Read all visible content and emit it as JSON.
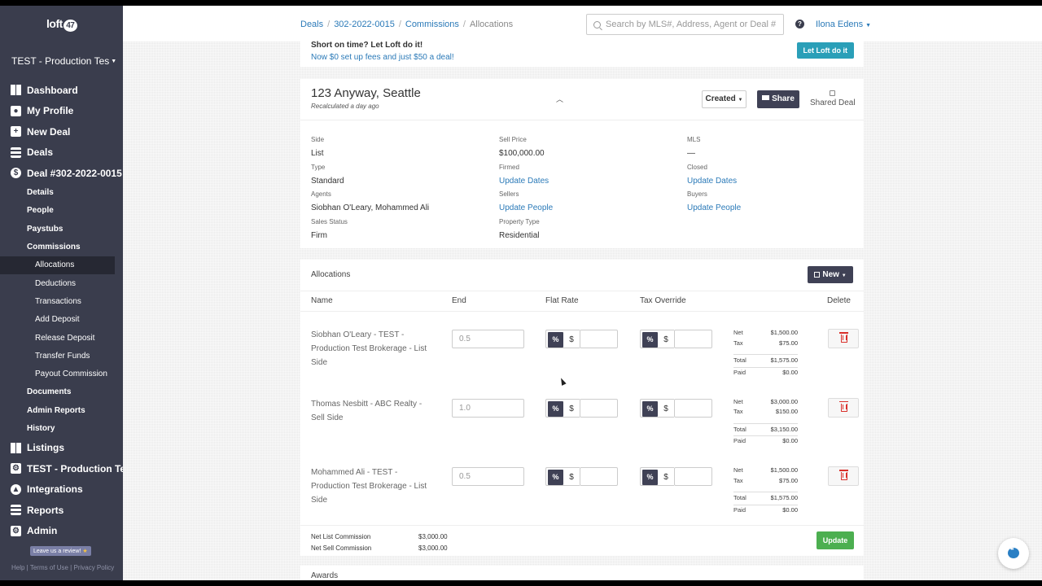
{
  "sidebar": {
    "logo": "loft",
    "logo_badge": "47",
    "org": "TEST - Production Tes",
    "nav": [
      {
        "label": "Dashboard",
        "icon": "dashboard-icon"
      },
      {
        "label": "My Profile",
        "icon": "profile-icon"
      },
      {
        "label": "New Deal",
        "icon": "plus-icon"
      },
      {
        "label": "Deals",
        "icon": "list-icon"
      },
      {
        "label": "Deal #302-2022-0015",
        "icon": "dollar-icon"
      }
    ],
    "sub": [
      {
        "label": "Details"
      },
      {
        "label": "People"
      },
      {
        "label": "Paystubs"
      },
      {
        "label": "Commissions"
      }
    ],
    "deep": [
      {
        "label": "Allocations"
      },
      {
        "label": "Deductions"
      },
      {
        "label": "Transactions"
      },
      {
        "label": "Add Deposit"
      },
      {
        "label": "Release Deposit"
      },
      {
        "label": "Transfer Funds"
      },
      {
        "label": "Payout Commission"
      }
    ],
    "sub2": [
      {
        "label": "Documents"
      },
      {
        "label": "Admin Reports"
      },
      {
        "label": "History"
      }
    ],
    "nav2": [
      {
        "label": "Listings",
        "icon": "grid-icon"
      },
      {
        "label": "TEST - Production Test",
        "icon": "building-icon"
      },
      {
        "label": "Integrations",
        "icon": "cloud-icon"
      },
      {
        "label": "Reports",
        "icon": "reports-icon"
      },
      {
        "label": "Admin",
        "icon": "admin-icon"
      }
    ],
    "review": "Leave us a review!",
    "footer": "Help | Terms of Use | Privacy Policy"
  },
  "topbar": {
    "breadcrumbs": [
      "Deals",
      "302-2022-0015",
      "Commissions"
    ],
    "current": "Allocations",
    "search_placeholder": "Search by MLS#, Address, Agent or Deal #",
    "help": "?",
    "user": "Ilona Edens"
  },
  "promo": {
    "line1": "Short on time? Let Loft do it!",
    "line2": "Now $0 set up fees and just $50 a deal!",
    "button": "Let Loft do it"
  },
  "deal": {
    "title": "123 Anyway, Seattle",
    "recalc": "Recalculated a day ago",
    "status_button": "Created",
    "share_button": "Share",
    "shared_label": "Shared Deal",
    "fields": [
      {
        "label": "Side",
        "value": "List",
        "link": false
      },
      {
        "label": "Sell Price",
        "value": "$100,000.00",
        "link": false
      },
      {
        "label": "MLS",
        "value": "—",
        "link": false
      },
      {
        "label": "Type",
        "value": "Standard",
        "link": false
      },
      {
        "label": "Firmed",
        "value": "Update Dates",
        "link": true
      },
      {
        "label": "Closed",
        "value": "Update Dates",
        "link": true
      },
      {
        "label": "Agents",
        "value": "Siobhan O'Leary, Mohammed Ali",
        "link": false
      },
      {
        "label": "Sellers",
        "value": "Update People",
        "link": true
      },
      {
        "label": "Buyers",
        "value": "Update People",
        "link": true
      },
      {
        "label": "Sales Status",
        "value": "Firm",
        "link": false
      },
      {
        "label": "Property Type",
        "value": "Residential",
        "link": false
      }
    ]
  },
  "allocations": {
    "title": "Allocations",
    "new_button": "New",
    "columns": [
      "Name",
      "End",
      "Flat Rate",
      "Tax Override",
      "Delete"
    ],
    "rows": [
      {
        "name": "Siobhan O'Leary - TEST - Production Test Brokerage - List Side",
        "end": "0.5",
        "net": "$1,500.00",
        "tax": "$75.00",
        "total": "$1,575.00",
        "paid": "$0.00"
      },
      {
        "name": "Thomas Nesbitt - ABC Realty - Sell Side",
        "end": "1.0",
        "net": "$3,000.00",
        "tax": "$150.00",
        "total": "$3,150.00",
        "paid": "$0.00"
      },
      {
        "name": "Mohammed Ali - TEST - Production Test Brokerage - List Side",
        "end": "0.5",
        "net": "$1,500.00",
        "tax": "$75.00",
        "total": "$1,575.00",
        "paid": "$0.00"
      }
    ],
    "labels": {
      "pct": "%",
      "dollar": "$",
      "net": "Net",
      "tax": "Tax",
      "total": "Total",
      "paid": "Paid"
    },
    "net_list_label": "Net List Commission",
    "net_list_value": "$3,000.00",
    "net_sell_label": "Net Sell Commission",
    "net_sell_value": "$3,000.00",
    "update_button": "Update"
  },
  "awards": {
    "title": "Awards"
  }
}
